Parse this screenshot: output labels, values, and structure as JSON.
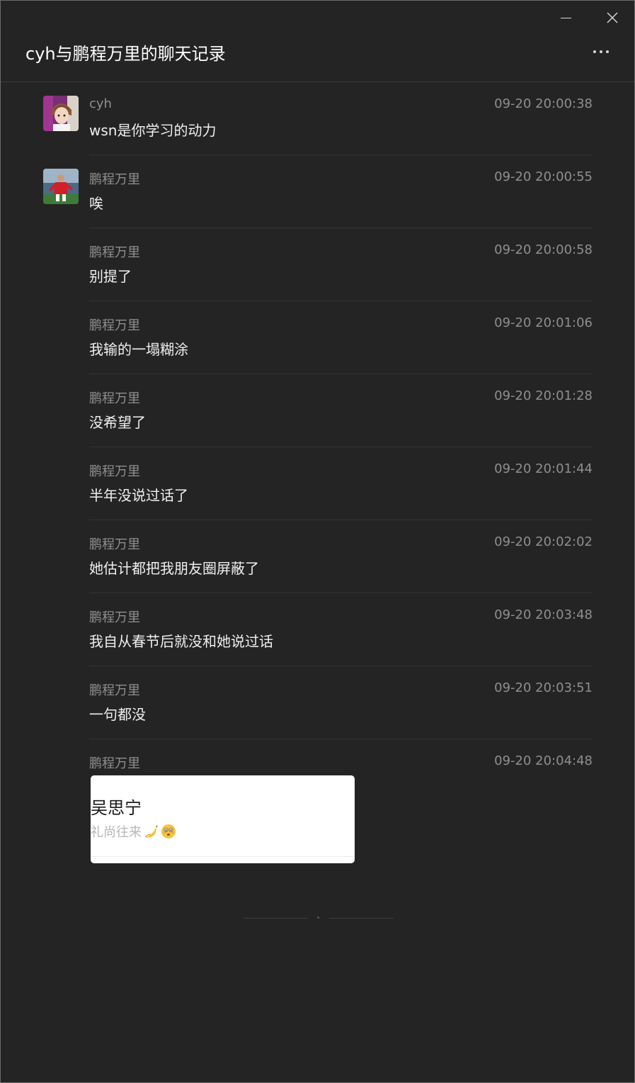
{
  "window": {
    "title": "cyh与鹏程万里的聊天记录"
  },
  "messages": [
    {
      "sender": "cyh",
      "time": "09-20 20:00:38",
      "text": "wsn是你学习的动力",
      "avatar": "anime-avatar"
    },
    {
      "sender": "鹏程万里",
      "time": "09-20 20:00:55",
      "text": "唉",
      "avatar": "soccer-avatar"
    },
    {
      "sender": "鹏程万里",
      "time": "09-20 20:00:58",
      "text": "别提了"
    },
    {
      "sender": "鹏程万里",
      "time": "09-20 20:01:06",
      "text": "我输的一塌糊涂"
    },
    {
      "sender": "鹏程万里",
      "time": "09-20 20:01:28",
      "text": "没希望了"
    },
    {
      "sender": "鹏程万里",
      "time": "09-20 20:01:44",
      "text": "半年没说过话了"
    },
    {
      "sender": "鹏程万里",
      "time": "09-20 20:02:02",
      "text": "她估计都把我朋友圈屏蔽了"
    },
    {
      "sender": "鹏程万里",
      "time": "09-20 20:03:48",
      "text": "我自从春节后就没和她说过话"
    },
    {
      "sender": "鹏程万里",
      "time": "09-20 20:03:51",
      "text": "一句都没"
    },
    {
      "sender": "鹏程万里",
      "time": "09-20 20:04:48",
      "image": {
        "name": "吴思宁",
        "subtitle": "礼尚往来",
        "emojis": [
          "banana-emoji",
          "flushed-face-emoji"
        ]
      }
    }
  ],
  "colors": {
    "background": "#242424",
    "text_primary": "#f0f0f0",
    "text_secondary": "#8f8f8f",
    "separator": "#333333"
  },
  "icons": {
    "minimize": "minimize-icon",
    "close": "close-icon",
    "more": "more-icon"
  }
}
